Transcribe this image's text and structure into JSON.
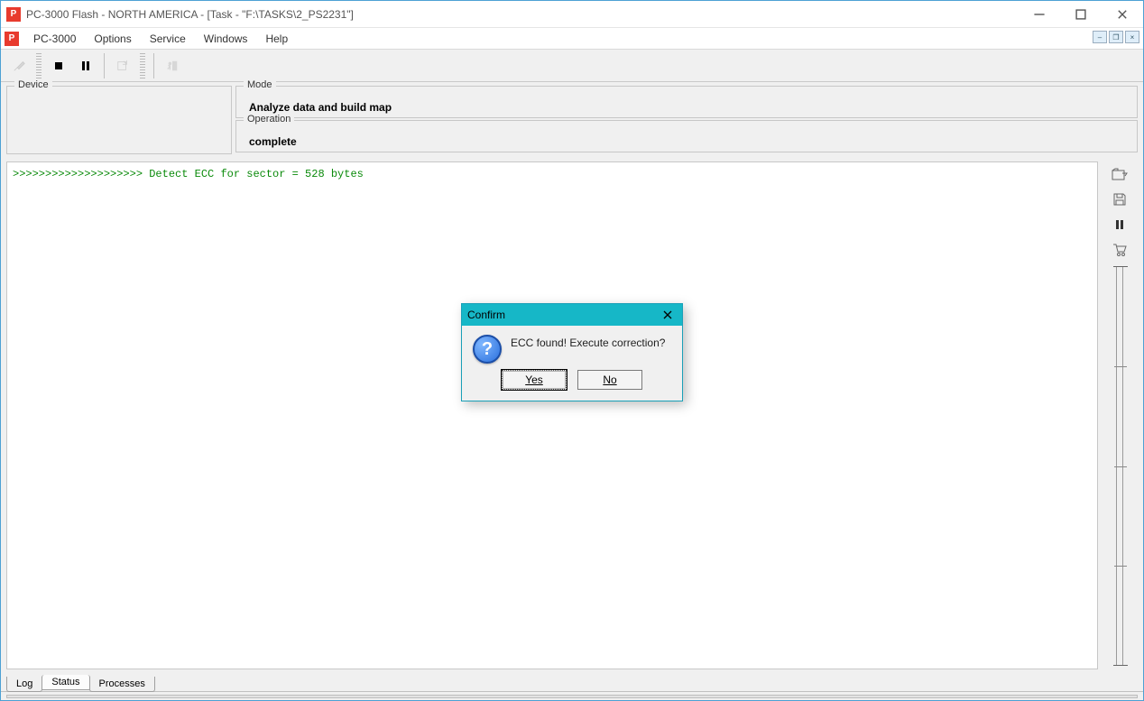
{
  "titlebar": {
    "text": "PC-3000 Flash - NORTH AMERICA - [Task - \"F:\\TASKS\\2_PS2231\"]"
  },
  "menu": {
    "items": [
      "PC-3000",
      "Options",
      "Service",
      "Windows",
      "Help"
    ]
  },
  "groups": {
    "device": {
      "legend": "Device",
      "value": ""
    },
    "mode": {
      "legend": "Mode",
      "value": "Analyze data and build map"
    },
    "operation": {
      "legend": "Operation",
      "value": "complete"
    }
  },
  "log": {
    "line1": ">>>>>>>>>>>>>>>>>>>> Detect ECC for sector = 528 bytes"
  },
  "tabs": {
    "items": [
      "Log",
      "Status",
      "Processes"
    ],
    "active_index": 1
  },
  "dialog": {
    "title": "Confirm",
    "message": "ECC  found! Execute correction?",
    "yes": "Yes",
    "no": "No"
  }
}
